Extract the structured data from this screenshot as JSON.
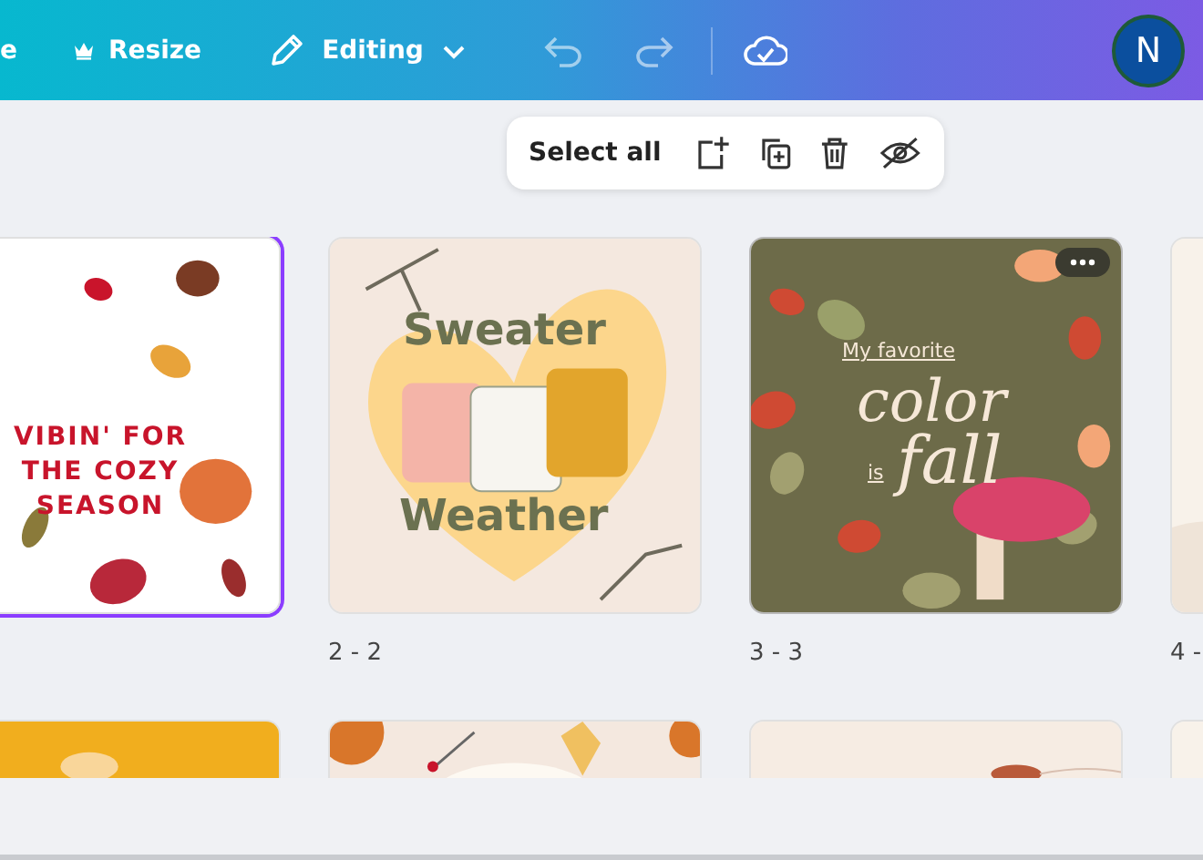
{
  "header": {
    "cut_label": "e",
    "resize": "Resize",
    "mode": "Editing",
    "avatar": "N"
  },
  "selection_toolbar": {
    "label": "Select all"
  },
  "pages": [
    {
      "kind": "leaves",
      "selected": true,
      "hovered": false,
      "texts": [
        "VIBIN' FOR THE COZY SEASON"
      ]
    },
    {
      "kind": "sweaters",
      "selected": false,
      "hovered": false,
      "texts": [
        "Sweater",
        "Weather"
      ],
      "label": "2 - 2"
    },
    {
      "kind": "wreath",
      "selected": false,
      "hovered": true,
      "texts": [
        "My favorite",
        "color",
        "is",
        "fall"
      ],
      "label": "3 - 3"
    },
    {
      "kind": "cream",
      "selected": false,
      "hovered": false,
      "label": "4 -"
    }
  ],
  "next_pages": [
    {
      "kind": "yellow"
    },
    {
      "kind": "berries"
    },
    {
      "kind": "cream-leaf"
    },
    {
      "kind": "cream"
    }
  ]
}
